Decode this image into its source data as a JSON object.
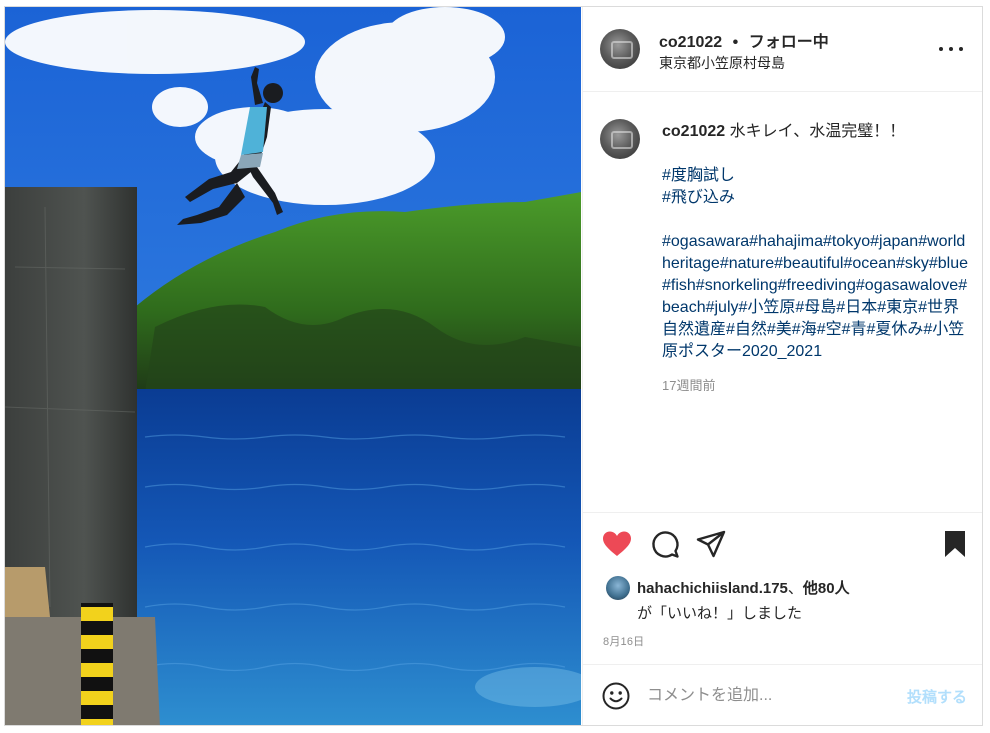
{
  "post": {
    "username": "co21022",
    "separator": "•",
    "follow_status": "フォロー中",
    "location": "東京都小笠原村母島"
  },
  "caption": {
    "username": "co21022",
    "text": "水キレイ、水温完璧！！",
    "tag_lines": [
      "#度胸試し",
      "#飛び込み"
    ],
    "hashtags": "#ogasawara#hahajima#tokyo#japan#worldheritage#nature#beautiful#ocean#sky#blue#fish#snorkeling#freediving#ogasawalove#beach#july#小笠原#母島#日本#東京#世界自然遺産#自然#美#海#空#青#夏休み#小笠原ポスター2020_2021",
    "time_ago": "17週間前"
  },
  "icons": {
    "more": "more-options-icon",
    "like": "heart-icon",
    "comment": "comment-icon",
    "share": "share-icon",
    "save": "bookmark-icon",
    "emoji": "emoji-icon"
  },
  "colors": {
    "like_active": "#ed4956",
    "hashtag": "#00376b",
    "post_button_disabled": "#b2dffc",
    "secondary_text": "#8e8e8e"
  },
  "likes": {
    "liker": "hahachichiisland.175",
    "separator": "、",
    "others": "他80人",
    "suffix": "が「いいね！」しました"
  },
  "post_date": "8月16日",
  "comment": {
    "placeholder": "コメントを追加...",
    "value": "",
    "submit_label": "投稿する"
  }
}
